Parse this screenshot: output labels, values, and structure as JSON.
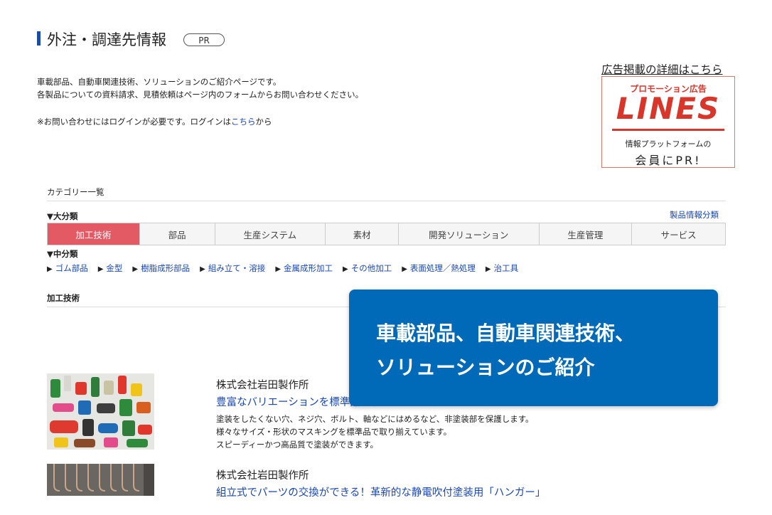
{
  "header": {
    "title": "外注・調達先情報",
    "badge": "PR"
  },
  "intro": {
    "line1": "車載部品、自動車関連技術、ソリューションのご紹介ページです。",
    "line2": "各製品についての資料請求、見積依頼はページ内のフォームからお問い合わせください。",
    "login_prefix": "※お問い合わせにはログインが必要です。ログインは",
    "login_link": "こちら",
    "login_suffix": "から"
  },
  "ad": {
    "caption": "広告掲載の詳細はこちら",
    "small": "プロモーション広告",
    "brand": "LINES",
    "sub1": "情報プラットフォームの",
    "sub2": "会員にPR!"
  },
  "categories": {
    "heading": "カテゴリー一覧",
    "major_label": "▼大分類",
    "spec_link": "製品情報分類",
    "tabs": [
      "加工技術",
      "部品",
      "生産システム",
      "素材",
      "開発ソリューション",
      "生産管理",
      "サービス"
    ],
    "active_tab": "加工技術",
    "minor_label": "▼中分類",
    "subcats": [
      "ゴム部品",
      "金型",
      "樹脂成形部品",
      "組み立て・溶接",
      "金属成形加工",
      "その他加工",
      "表面処理／熱処理",
      "治工具"
    ]
  },
  "section": {
    "heading": "加工技術"
  },
  "products": [
    {
      "company": "株式会社岩田製作所",
      "title": "豊富なバリエーションを標準品で取り揃えた塗装・メッキ用マスキング",
      "desc": [
        "塗装をしたくない穴、ネジ穴、ボルト、軸などにはめるなど、非塗装部を保護します。",
        "様々なサイズ・形状のマスキングを標準品で取り揃えています。",
        "スピーディーかつ高品質で塗装ができます。"
      ]
    },
    {
      "company": "株式会社岩田製作所",
      "title": "組立式でパーツの交換ができる！革新的な静電吹付塗装用「ハンガー」"
    }
  ],
  "tooltip": {
    "line1": "車載部品、自動車関連技術、",
    "line2": "ソリューションのご紹介"
  },
  "colors": {
    "accent_blue": "#1a4da8",
    "link_blue": "#1a47b5",
    "active_tab": "#e35a64",
    "tooltip_bg": "#0069b8",
    "brand_red": "#d8362a"
  }
}
